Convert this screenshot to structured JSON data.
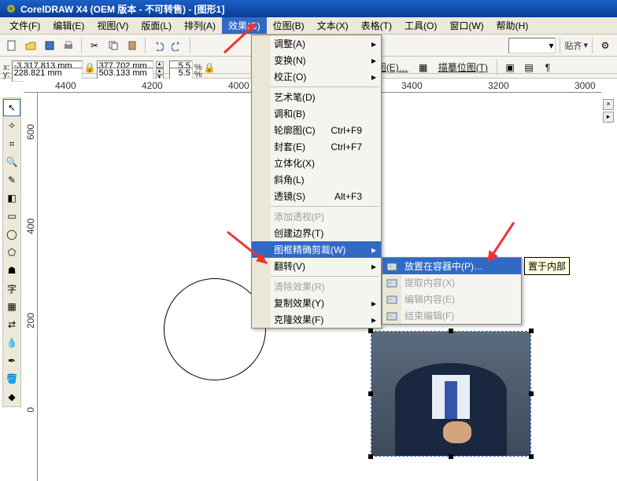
{
  "title": "CorelDRAW X4 (OEM 版本 - 不可转售) - [图形1]",
  "menubar": [
    "文件(F)",
    "编辑(E)",
    "视图(V)",
    "版面(L)",
    "排列(A)",
    "效果(C)",
    "位图(B)",
    "文本(X)",
    "表格(T)",
    "工具(O)",
    "窗口(W)",
    "帮助(H)"
  ],
  "open_menu_index": 5,
  "coords": {
    "x_label": "x:",
    "y_label": "y:",
    "x": "-3,317.813 mm",
    "y": "228.821 mm",
    "w": "377.702 mm",
    "h": "503.133 mm",
    "sx": "5.5",
    "sy": "5.5",
    "pct": "%"
  },
  "snap_label": "贴齐",
  "links": {
    "edit_bitmap": "编辑位图(E)…",
    "trace_bitmap": "描摹位图(T)"
  },
  "ruler_h": [
    "4400",
    "4200",
    "4000",
    "3400",
    "3200",
    "3000"
  ],
  "ruler_v": [
    "600",
    "400",
    "200",
    "0"
  ],
  "effects_menu": [
    {
      "t": "调整(A)",
      "arrow": true
    },
    {
      "t": "变换(N)",
      "arrow": true
    },
    {
      "t": "校正(O)",
      "arrow": true
    },
    {
      "sep": true
    },
    {
      "t": "艺术笔(D)"
    },
    {
      "t": "调和(B)"
    },
    {
      "t": "轮廓图(C)",
      "sc": "Ctrl+F9"
    },
    {
      "t": "封套(E)",
      "sc": "Ctrl+F7"
    },
    {
      "t": "立体化(X)"
    },
    {
      "t": "斜角(L)"
    },
    {
      "t": "透镜(S)",
      "sc": "Alt+F3"
    },
    {
      "sep": true
    },
    {
      "t": "添加透视(P)",
      "dis": true
    },
    {
      "t": "创建边界(T)"
    },
    {
      "t": "图框精确剪裁(W)",
      "arrow": true,
      "hl": true
    },
    {
      "t": "翻转(V)",
      "arrow": true
    },
    {
      "sep": true
    },
    {
      "t": "清除效果(R)",
      "dis": true
    },
    {
      "t": "复制效果(Y)",
      "arrow": true
    },
    {
      "t": "克隆效果(F)",
      "arrow": true
    }
  ],
  "sub_menu": [
    {
      "t": "放置在容器中(P)…",
      "hl": true
    },
    {
      "t": "提取内容(X)",
      "dis": true
    },
    {
      "t": "编辑内容(E)",
      "dis": true
    },
    {
      "t": "结束编辑(F)",
      "dis": true
    }
  ],
  "tooltip": "置于内部"
}
